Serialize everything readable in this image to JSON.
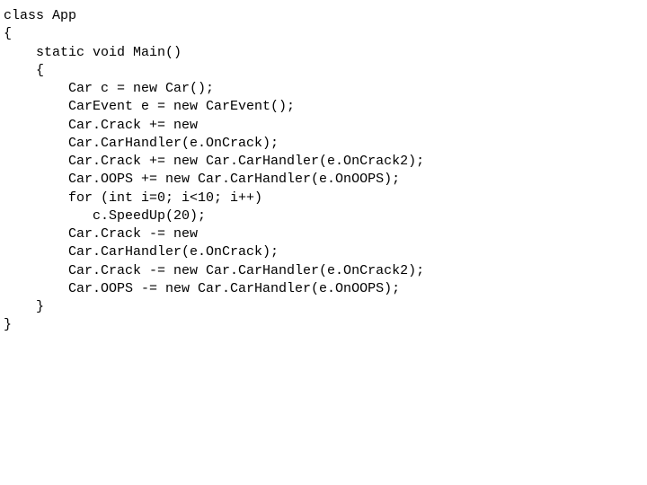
{
  "code": {
    "lines": [
      "class App",
      "{",
      "    static void Main()",
      "    {",
      "        Car c = new Car();",
      "        CarEvent e = new CarEvent();",
      "        Car.Crack += new",
      "        Car.CarHandler(e.OnCrack);",
      "        Car.Crack += new Car.CarHandler(e.OnCrack2);",
      "        Car.OOPS += new Car.CarHandler(e.OnOOPS);",
      "        for (int i=0; i<10; i++)",
      "           c.SpeedUp(20);",
      "        Car.Crack -= new",
      "        Car.CarHandler(e.OnCrack);",
      "        Car.Crack -= new Car.CarHandler(e.OnCrack2);",
      "        Car.OOPS -= new Car.CarHandler(e.OnOOPS);",
      "    }",
      "}"
    ]
  }
}
